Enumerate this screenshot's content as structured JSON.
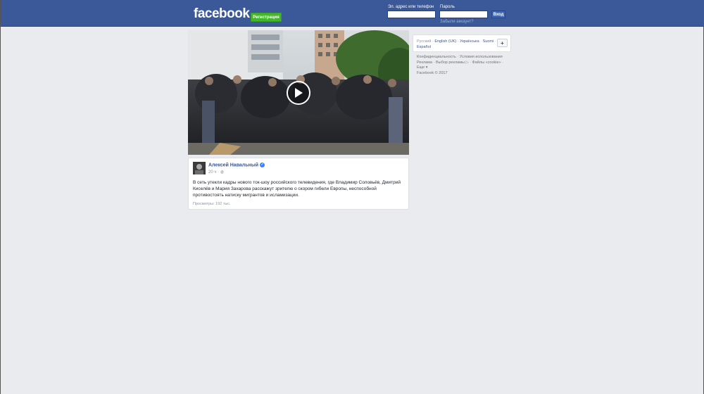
{
  "header": {
    "logo": "facebook",
    "register_label": "Регистрация",
    "email_label": "Эл. адрес или телефон",
    "password_label": "Пароль",
    "login_label": "Вход",
    "forgot_label": "Забыли аккаунт?"
  },
  "post": {
    "author": "Алексей Навальный",
    "time": "20 ч",
    "text": "В сеть утекли кадры нового ток-шоу российского телевидения, где Владимир Соловьёв, Дмитрий Киселёв и Мария Захарова расскажут зрителю о скором гибели Европы, неспособной противостоять натиску мигрантов и исламизации.",
    "views": "Просмотры: 192 тыс."
  },
  "languages": {
    "items": [
      "Русский",
      "English (UK)",
      "Українська",
      "Suomi",
      "Español"
    ],
    "plus": "+"
  },
  "footer": {
    "links": [
      "Конфиденциальность",
      "Условия использования",
      "Реклама",
      "Выбор рекламы",
      "Файлы «cookie»",
      "Еще"
    ],
    "copyright": "Facebook © 2017"
  },
  "colors": {
    "brand": "#3b5998",
    "register_green": "#42b72a",
    "link": "#365899",
    "background": "#e9ebee"
  }
}
